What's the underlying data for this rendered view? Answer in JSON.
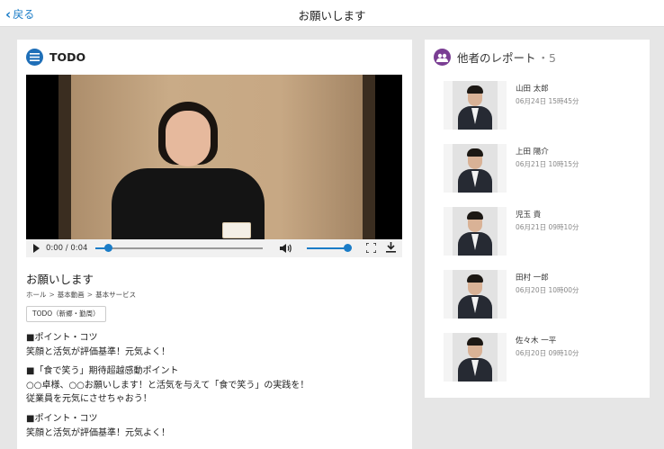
{
  "header": {
    "back_label": "戻る",
    "title": "お願いします"
  },
  "todo_card": {
    "title": "TODO",
    "video": {
      "time_display": "0:00 / 0:04",
      "progress_fraction": 0.08,
      "volume_fraction": 0.95
    },
    "content_title": "お願いします",
    "breadcrumbs": [
      "ホール",
      "基本動画",
      "基本サービス"
    ],
    "breadcrumb_sep": ">",
    "tag": "TODO（新郷・勤周）",
    "sections": [
      [
        "■ポイント・コツ",
        "笑顔と活気が評価基準！元気よく！"
      ],
      [
        "■「食で笑う」期待超越感動ポイント",
        "○○卓様、○○お願いします！と活気を与えて「食で笑う」の実践を！",
        "従業員を元気にさせちゃおう！"
      ],
      [
        "■ポイント・コツ",
        "笑顔と活気が評価基準！元気よく！"
      ]
    ]
  },
  "reports_card": {
    "title": "他者のレポート",
    "count": "・5",
    "items": [
      {
        "name": "山田 太郎",
        "date": "06月24日 15時45分"
      },
      {
        "name": "上田 陽介",
        "date": "06月21日 10時15分"
      },
      {
        "name": "児玉 貴",
        "date": "06月21日 09時10分"
      },
      {
        "name": "田村 一郎",
        "date": "06月20日 10時00分"
      },
      {
        "name": "佐々木 一平",
        "date": "06月20日 09時10分"
      }
    ]
  },
  "colors": {
    "accent": "#1a7cc7",
    "todo_icon": "#1f6fb8",
    "report_icon": "#7a3e93"
  }
}
